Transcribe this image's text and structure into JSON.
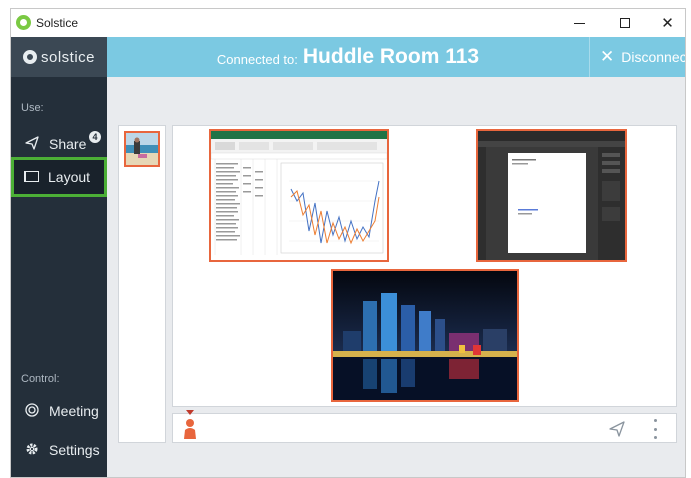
{
  "window": {
    "title": "Solstice",
    "controls": {
      "minimize_icon": "minimize-icon",
      "maximize_icon": "maximize-icon",
      "close_label": "✕"
    }
  },
  "sidebar": {
    "logo_text": "solstice",
    "use_label": "Use:",
    "control_label": "Control:",
    "items": [
      {
        "label": "Share",
        "icon": "share-icon",
        "badge": "4"
      },
      {
        "label": "Layout",
        "icon": "monitor-icon",
        "selected": true
      },
      {
        "label": "Meeting",
        "icon": "meeting-icon"
      },
      {
        "label": "Settings",
        "icon": "gear-icon"
      }
    ]
  },
  "header": {
    "connected_label": "Connected to:",
    "room_name": "Huddle Room 113",
    "disconnect_label": "Disconnect"
  },
  "layout": {
    "source_thumbnails": [
      {
        "icon": "beach-photo-thumbnail"
      }
    ],
    "tiles": [
      {
        "name": "excel-spreadsheet-tile"
      },
      {
        "name": "illustrator-document-tile"
      },
      {
        "name": "city-night-photo-tile"
      }
    ]
  },
  "bottom_bar": {
    "person_icon": "person-icon",
    "send_icon": "send-icon",
    "menu_icon": "more-options-icon"
  },
  "colors": {
    "sidebar_bg": "#242f3a",
    "header_bg": "#7bc9e2",
    "selected_outline": "#4caf36",
    "tile_border": "#e8663d",
    "main_bg": "#e9ebee"
  }
}
